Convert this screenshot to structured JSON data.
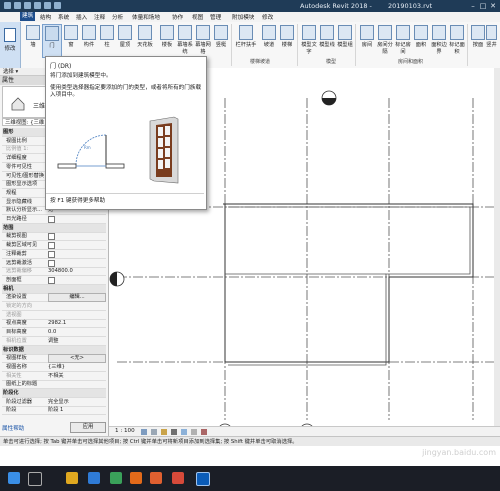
{
  "title": {
    "app": "Autodesk Revit 2018 -",
    "file": "20190103.rvt"
  },
  "tabs": [
    "建筑",
    "结构",
    "系统",
    "插入",
    "注释",
    "分析",
    "体量和场地",
    "协作",
    "视图",
    "管理",
    "附加模块",
    "修改"
  ],
  "active_tab": "建筑",
  "ribbon": {
    "modify": "修改",
    "select": "选择 ▾",
    "buttons": [
      "墙",
      "门",
      "窗",
      "构件",
      "柱",
      "屋顶",
      "天花板",
      "楼板",
      "幕墙系统",
      "幕墙网格",
      "竖梃",
      "栏杆扶手",
      "坡道",
      "楼梯",
      "模型文字",
      "模型线",
      "模型组",
      "房间",
      "房间分隔",
      "标记房间",
      "面积",
      "面积边界",
      "标记面积",
      "按面",
      "竖井"
    ],
    "groups": [
      "楼梯坡道",
      "模型",
      "房间和面积"
    ]
  },
  "tooltip": {
    "title": "门 (DR)",
    "line1": "将门添加到建筑模型中。",
    "line2": "使用类型选择器指定要添加的门的类型，或者将所有的门族载入项目中。",
    "hint": "按 F1 键获得更多帮助",
    "fig_label": "Rm"
  },
  "properties": {
    "header": "属性",
    "type_name": "三维",
    "filter": "三维视图: {三维}",
    "rows": [
      {
        "k": "图形",
        "type": "cat"
      },
      {
        "k": "视图比例",
        "v": ""
      },
      {
        "k": "比例值 1:",
        "v": "",
        "dim": true
      },
      {
        "k": "详细程度",
        "v": ""
      },
      {
        "k": "零件可见性",
        "v": ""
      },
      {
        "k": "可见性/图形替换",
        "v": ""
      },
      {
        "k": "图形显示选项",
        "v": ""
      },
      {
        "k": "规程",
        "v": ""
      },
      {
        "k": "显示隐藏线",
        "v": ""
      },
      {
        "k": "默认分析显示...",
        "v": "无"
      },
      {
        "k": "日光路径",
        "chk": true
      },
      {
        "k": "范围",
        "type": "cat"
      },
      {
        "k": "裁剪视图",
        "chk": true
      },
      {
        "k": "裁剪区域可见",
        "chk": true
      },
      {
        "k": "注释裁剪",
        "chk": true
      },
      {
        "k": "远剪裁激活",
        "chk": true
      },
      {
        "k": "远剪裁偏移",
        "v": "304800.0",
        "dim": true
      },
      {
        "k": "剖面框",
        "chk": true
      },
      {
        "k": "相机",
        "type": "cat"
      },
      {
        "k": "渲染设置",
        "btn": "编辑..."
      },
      {
        "k": "锁定的方向",
        "v": "",
        "dim": true
      },
      {
        "k": "透视图",
        "v": "",
        "dim": true
      },
      {
        "k": "视点高度",
        "v": "2982.1"
      },
      {
        "k": "目标高度",
        "v": "0.0"
      },
      {
        "k": "相机位置",
        "v": "调整",
        "dim": true
      },
      {
        "k": "标识数据",
        "type": "cat"
      },
      {
        "k": "视图样板",
        "btn": "<无>"
      },
      {
        "k": "视图名称",
        "v": "{三维}"
      },
      {
        "k": "相关性",
        "v": "不相关",
        "dim": true
      },
      {
        "k": "图纸上的标题",
        "v": ""
      },
      {
        "k": "阶段化",
        "type": "cat"
      },
      {
        "k": "阶段过滤器",
        "v": "完全显示"
      },
      {
        "k": "阶段",
        "v": "阶段 1"
      }
    ],
    "help": "属性帮助",
    "apply": "应用"
  },
  "canvas": {
    "grid_labels": [
      "4",
      "5",
      "6",
      "7"
    ]
  },
  "viewbar": {
    "scale": "1 : 100"
  },
  "status": {
    "text": "单击可进行选择; 按 Tab 键并单击可选择其他项目; 按 Ctrl 键并单击可将新项目添加到选择集; 按 Shift 键并单击可取消选择。"
  },
  "watermark": "jingyan.baidu.com",
  "colors": {
    "titlebar": "#1f3b57",
    "accent": "#1e4e8c"
  }
}
